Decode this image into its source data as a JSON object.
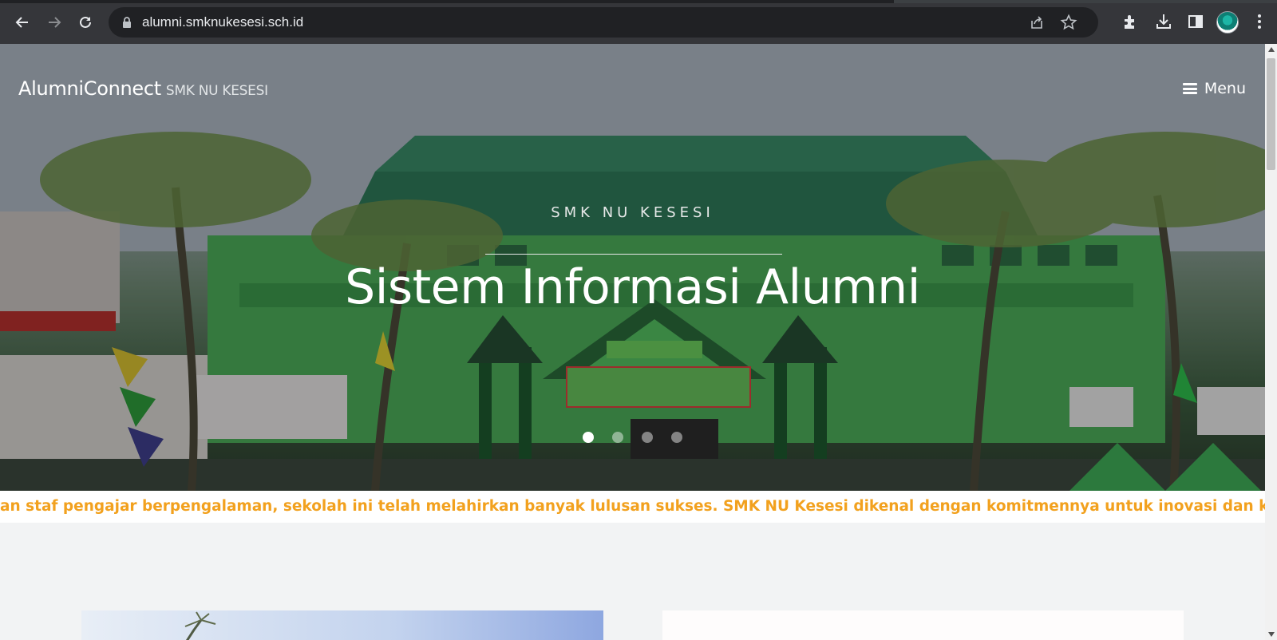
{
  "browser": {
    "url": "alumni.smknukesesi.sch.id",
    "icons": [
      "back-icon",
      "forward-icon",
      "reload-icon",
      "lock-icon",
      "share-icon",
      "star-icon",
      "extensions-icon",
      "download-icon",
      "side-panel-icon",
      "profile-avatar",
      "more-icon"
    ]
  },
  "nav": {
    "brand": "AlumniConnect",
    "brand_sub": "SMK NU KESESI",
    "menu_label": "Menu"
  },
  "hero": {
    "eyebrow": "SMK NU KESESI",
    "title": "Sistem Informasi Alumni",
    "slides_total": 4,
    "active_slide": 1
  },
  "marquee": {
    "text": "an staf pengajar berpengalaman, sekolah ini telah melahirkan banyak lulusan sukses. SMK NU Kesesi dikenal dengan komitmennya untuk inovasi dan kepemimpinan, se"
  },
  "colors": {
    "marquee_text": "#f2a11e",
    "chrome_bg": "#35363a",
    "omnibox_bg": "#202124"
  }
}
